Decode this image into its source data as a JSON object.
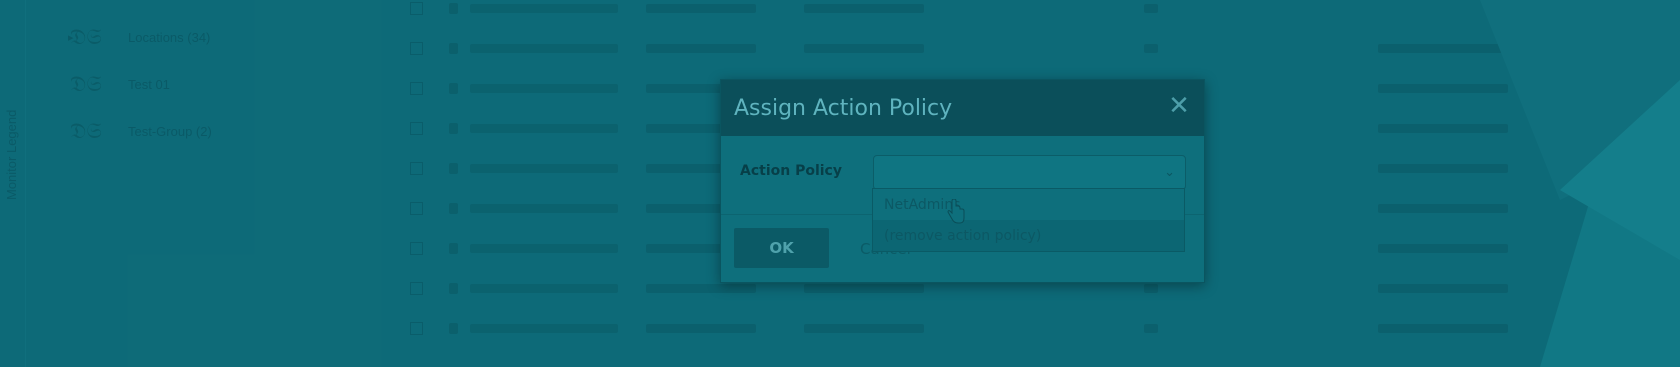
{
  "app": {
    "sidebar": {
      "vertical_label": "Monitor Legend"
    },
    "tree": [
      {
        "label": "Locations (34)",
        "has_caret": true
      },
      {
        "label": "Test 01",
        "has_caret": false
      },
      {
        "label": "Test-Group (2)",
        "has_caret": false
      }
    ]
  },
  "dialog": {
    "title": "Assign Action Policy",
    "field_label": "Action Policy",
    "select_value": "",
    "ok_label": "OK",
    "cancel_label": "Cancel",
    "options": [
      {
        "label": "NetAdmins"
      },
      {
        "label": "(remove action policy)"
      }
    ]
  },
  "colors": {
    "overlay": "#0e6c79",
    "dialog_header": "#0b4f5a",
    "title_text": "#5fb4bf"
  },
  "icons": {
    "close": "close-icon",
    "chevron": "chevron-down-icon",
    "cursor": "hand-pointer-icon",
    "tree_node": "map-node-icon"
  }
}
